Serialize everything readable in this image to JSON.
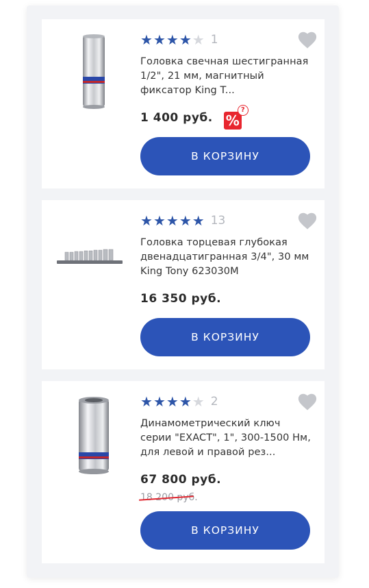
{
  "products": [
    {
      "rating": 4,
      "reviews": "1",
      "title": "Головка свечная шестигранная 1/2\", 21 мм, магнитный фиксатор King T...",
      "price": "1 400 руб.",
      "old_price": "",
      "discount_icon": "%",
      "discount_help": "?",
      "button": "В КОРЗИНУ"
    },
    {
      "rating": 5,
      "reviews": "13",
      "title": "Головка торцевая глубокая двенадцатигранная 3/4\", 30 мм King Tony 623030M",
      "price": "16 350 руб.",
      "old_price": "",
      "button": "В КОРЗИНУ"
    },
    {
      "rating": 4,
      "reviews": "2",
      "title": "Динамометрический ключ серии \"EXACT\", 1\", 300-1500 Нм, для левой и правой рез...",
      "price": "67 800 руб.",
      "old_price": "18 200 руб.",
      "button": "В КОРЗИНУ"
    }
  ],
  "colors": {
    "accent": "#2c54b8",
    "star": "#2d55a8",
    "star_empty": "#d6d8dd",
    "sale": "#e8262f",
    "heart": "#c4c6cb"
  },
  "icons": {
    "star": "star-icon",
    "wishlist": "heart-icon",
    "discount": "percent-icon",
    "help": "question-icon"
  }
}
